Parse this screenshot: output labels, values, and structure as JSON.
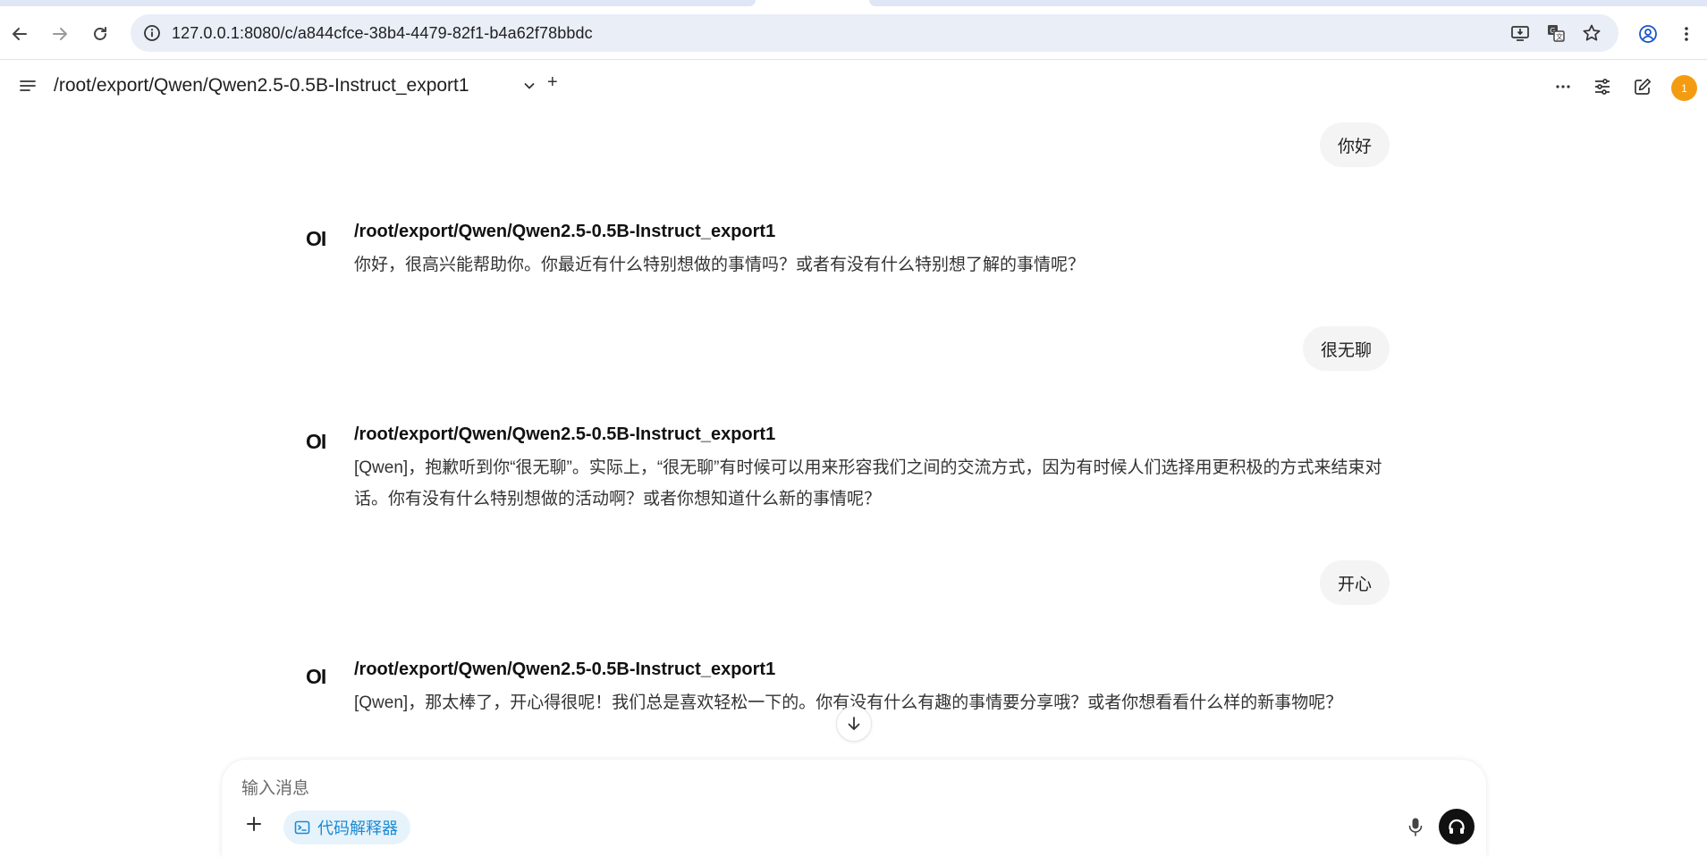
{
  "browser": {
    "url": "127.0.0.1:8080/c/a844cfce-38b4-4479-82f1-b4a62f78bbdc",
    "icons": [
      "back-icon",
      "forward-icon",
      "reload-icon",
      "site-info-icon",
      "install-app-icon",
      "translate-icon",
      "bookmark-star-icon",
      "profile-icon",
      "menu-kebab-icon"
    ]
  },
  "header": {
    "model_title": "/root/export/Qwen/Qwen2.5-0.5B-Instruct_export1",
    "add_label": "+",
    "avatar_badge": "1",
    "avatar_color": "#f39c12"
  },
  "chat": {
    "messages": [
      {
        "role": "user",
        "text": "你好"
      },
      {
        "role": "assistant",
        "logo": "OI",
        "name": "/root/export/Qwen/Qwen2.5-0.5B-Instruct_export1",
        "text": "你好，很高兴能帮助你。你最近有什么特别想做的事情吗？或者有没有什么特别想了解的事情呢？"
      },
      {
        "role": "user",
        "text": "很无聊"
      },
      {
        "role": "assistant",
        "logo": "OI",
        "name": "/root/export/Qwen/Qwen2.5-0.5B-Instruct_export1",
        "text": "[Qwen]，抱歉听到你“很无聊”。实际上，“很无聊”有时候可以用来形容我们之间的交流方式，因为有时候人们选择用更积极的方式来结束对话。你有没有什么特别想做的活动啊？或者你想知道什么新的事情呢？"
      },
      {
        "role": "user",
        "text": "开心"
      },
      {
        "role": "assistant",
        "logo": "OI",
        "name": "/root/export/Qwen/Qwen2.5-0.5B-Instruct_export1",
        "text": "[Qwen]，那太棒了，开心得很呢！我们总是喜欢轻松一下的。你有没有什么有趣的事情要分享哦？或者你想看看什么样的新事物呢？"
      }
    ]
  },
  "composer": {
    "placeholder": "输入消息",
    "code_interpreter_label": "代码解释器",
    "accent_color": "#1c8ad3"
  }
}
